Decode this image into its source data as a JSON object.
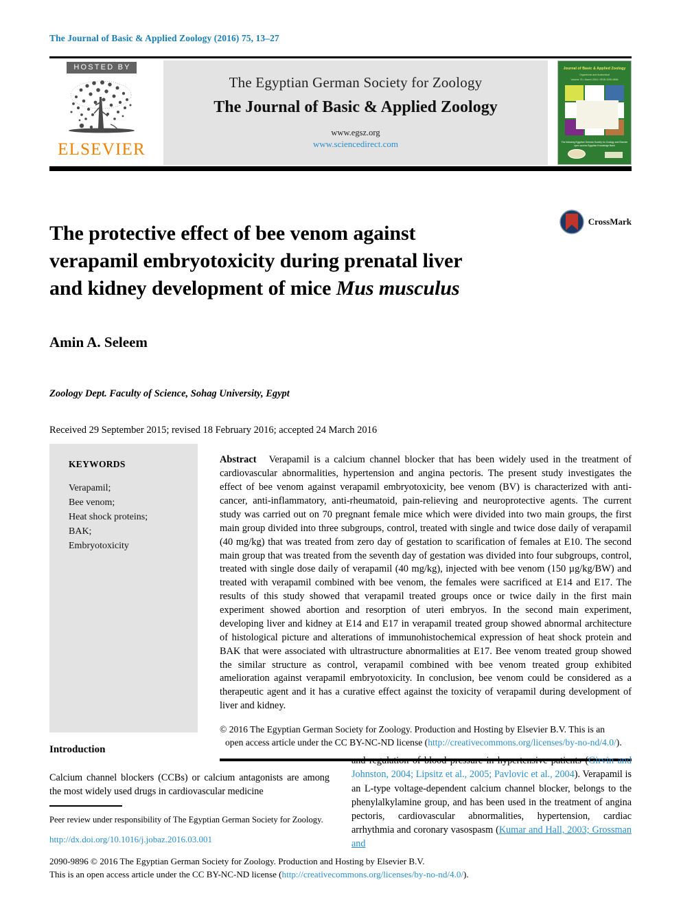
{
  "running_head": "The Journal of Basic & Applied Zoology (2016) 75, 13–27",
  "header": {
    "hosted_by": "HOSTED BY",
    "publisher": "ELSEVIER",
    "society_name": "The Egyptian German Society for Zoology",
    "journal_name": "The Journal of Basic & Applied Zoology",
    "url_society": "www.egsz.org",
    "url_sciencedirect": "www.sciencedirect.com",
    "cover": {
      "title": "Journal of Basic & Applied Zoology",
      "subtitle": "Organismic and Anatomical",
      "issue_line": "Volume 75 • March 2016 • ISSN 2090-9896",
      "footer_line": "The following\nEgyptian German Society for Zoology\nand Elsevier\nopen access\nEgyptian Knowledge Bank"
    }
  },
  "article": {
    "title_line1": "The protective effect of bee venom against",
    "title_line2": "verapamil embryotoxicity during prenatal liver",
    "title_line3_prefix": "and kidney development of mice ",
    "title_line3_species": "Mus musculus",
    "crossmark_label": "CrossMark",
    "author": "Amin A. Seleem",
    "affiliation": "Zoology Dept. Faculty of Science, Sohag University, Egypt",
    "history": "Received 29 September 2015; revised 18 February 2016; accepted 24 March 2016"
  },
  "keywords": {
    "heading": "KEYWORDS",
    "items": [
      "Verapamil;",
      "Bee venom;",
      "Heat shock proteins;",
      "BAK;",
      "Embryotoxicity"
    ]
  },
  "abstract": {
    "label": "Abstract",
    "text": "Verapamil is a calcium channel blocker that has been widely used in the treatment of cardiovascular abnormalities, hypertension and angina pectoris. The present study investigates the effect of bee venom against verapamil embryotoxicity, bee venom (BV) is characterized with anti-cancer, anti-inflammatory, anti-rheumatoid, pain-relieving and neuroprotective agents. The current study was carried out on 70 pregnant female mice which were divided into two main groups, the first main group divided into three subgroups, control, treated with single and twice dose daily of verapamil (40 mg/kg) that was treated from zero day of gestation to scarification of females at E10. The second main group that was treated from the seventh day of gestation was divided into four subgroups, control, treated with single dose daily of verapamil (40 mg/kg), injected with bee venom (150 µg/kg/BW) and treated with verapamil combined with bee venom, the females were sacrificed at E14 and E17. The results of this study showed that verapamil treated groups once or twice daily in the first main experiment showed abortion and resorption of uteri embryos. In the second main experiment, developing liver and kidney at E14 and E17 in verapamil treated group showed abnormal architecture of histological picture and alterations of immunohistochemical expression of heat shock protein and BAK that were associated with ultrastructure abnormalities at E17. Bee venom treated group showed the similar structure as control, verapamil combined with bee venom treated group exhibited amelioration against verapamil embryotoxicity. In conclusion, bee venom could be considered as a therapeutic agent and it has a curative effect against the toxicity of verapamil during development of liver and kidney.",
    "copyright_line1": "© 2016 The Egyptian German Society for Zoology. Production and Hosting by Elsevier B.V. This is an",
    "copyright_line2_prefix": "open access article under the CC BY-NC-ND license (",
    "copyright_link": "http://creativecommons.org/licenses/by-no-nd/4.0/",
    "copyright_line2_suffix": ")."
  },
  "introduction": {
    "heading": "Introduction",
    "left_text": "Calcium channel blockers (CCBs) or calcium antagonists are among the most widely used drugs in cardiovascular medicine",
    "right_text_1": "and regulation of blood pressure in hypertensive patients (",
    "right_cite_1": "Girvin and Johnston, 2004; Lipsitz et al., 2005; Pavlovic et al., 2004",
    "right_text_2": "). Verapamil is an L-type voltage-dependent calcium channel blocker, belongs to the phenylalkylamine group, and has been used in the treatment of angina pectoris, cardiovascular abnormalities, hypertension, cardiac arrhythmia and coronary vasospasm (",
    "right_cite_2": "Kumar and Hall, 2003; Grossman and"
  },
  "footer": {
    "peer_review": "Peer review under responsibility of The Egyptian German Society for Zoology.",
    "doi": "http://dx.doi.org/10.1016/j.jobaz.2016.03.001",
    "legal_line1": "2090-9896 © 2016 The Egyptian German Society for Zoology. Production and Hosting by Elsevier B.V.",
    "legal_line2_prefix": "This is an open access article under the CC BY-NC-ND license (",
    "legal_link": "http://creativecommons.org/licenses/by-no-nd/4.0/",
    "legal_line2_suffix": ")."
  },
  "colors": {
    "link_blue": "#2a8fcd",
    "running_head_blue": "#1a7fb5",
    "elsevier_orange": "#ef8200",
    "panel_gray": "#e3e3e3",
    "cover_green": "#2e7d32",
    "crossmark_red": "#c0352b",
    "crossmark_blue": "#1b3a63"
  }
}
